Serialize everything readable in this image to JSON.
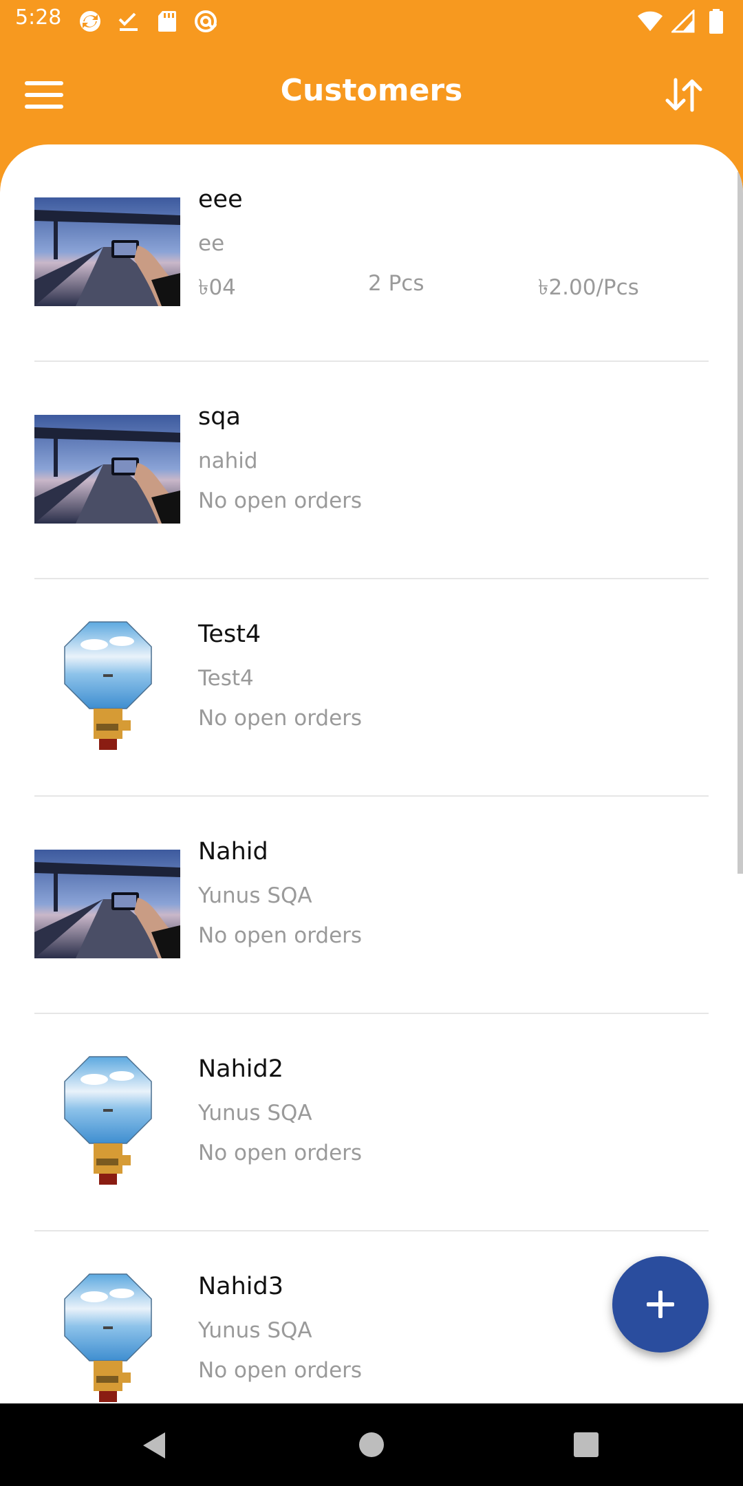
{
  "status_bar": {
    "time": "5:28",
    "left_icons": [
      "sync-icon",
      "check-icon",
      "sd-card-icon",
      "at-icon"
    ],
    "right_icons": [
      "wifi-icon",
      "signal-icon",
      "battery-icon"
    ]
  },
  "app_bar": {
    "title": "Customers",
    "menu_icon": "hamburger-menu-icon",
    "sort_icon": "sort-arrows-icon",
    "background": "#F7991F"
  },
  "customers": [
    {
      "name": "eee",
      "subtitle": "ee",
      "amount": "৳04",
      "quantity": "2 Pcs",
      "price": "৳2.00/Pcs",
      "thumbnail": "bridge-photo"
    },
    {
      "name": "sqa",
      "subtitle": "nahid",
      "status": "No open orders",
      "thumbnail": "bridge-photo"
    },
    {
      "name": "Test4",
      "subtitle": "Test4",
      "status": "No open orders",
      "thumbnail": "display-module-photo"
    },
    {
      "name": "Nahid",
      "subtitle": "Yunus SQA",
      "status": "No open orders",
      "thumbnail": "bridge-photo"
    },
    {
      "name": "Nahid2",
      "subtitle": "Yunus SQA",
      "status": "No open orders",
      "thumbnail": "display-module-photo"
    },
    {
      "name": "Nahid3",
      "subtitle": "Yunus SQA",
      "status": "No open orders",
      "thumbnail": "display-module-photo"
    }
  ],
  "fab": {
    "icon": "plus-icon",
    "color": "#2A4D9E"
  },
  "nav_bar": {
    "icons": [
      "back-icon",
      "home-icon",
      "recents-icon"
    ]
  }
}
